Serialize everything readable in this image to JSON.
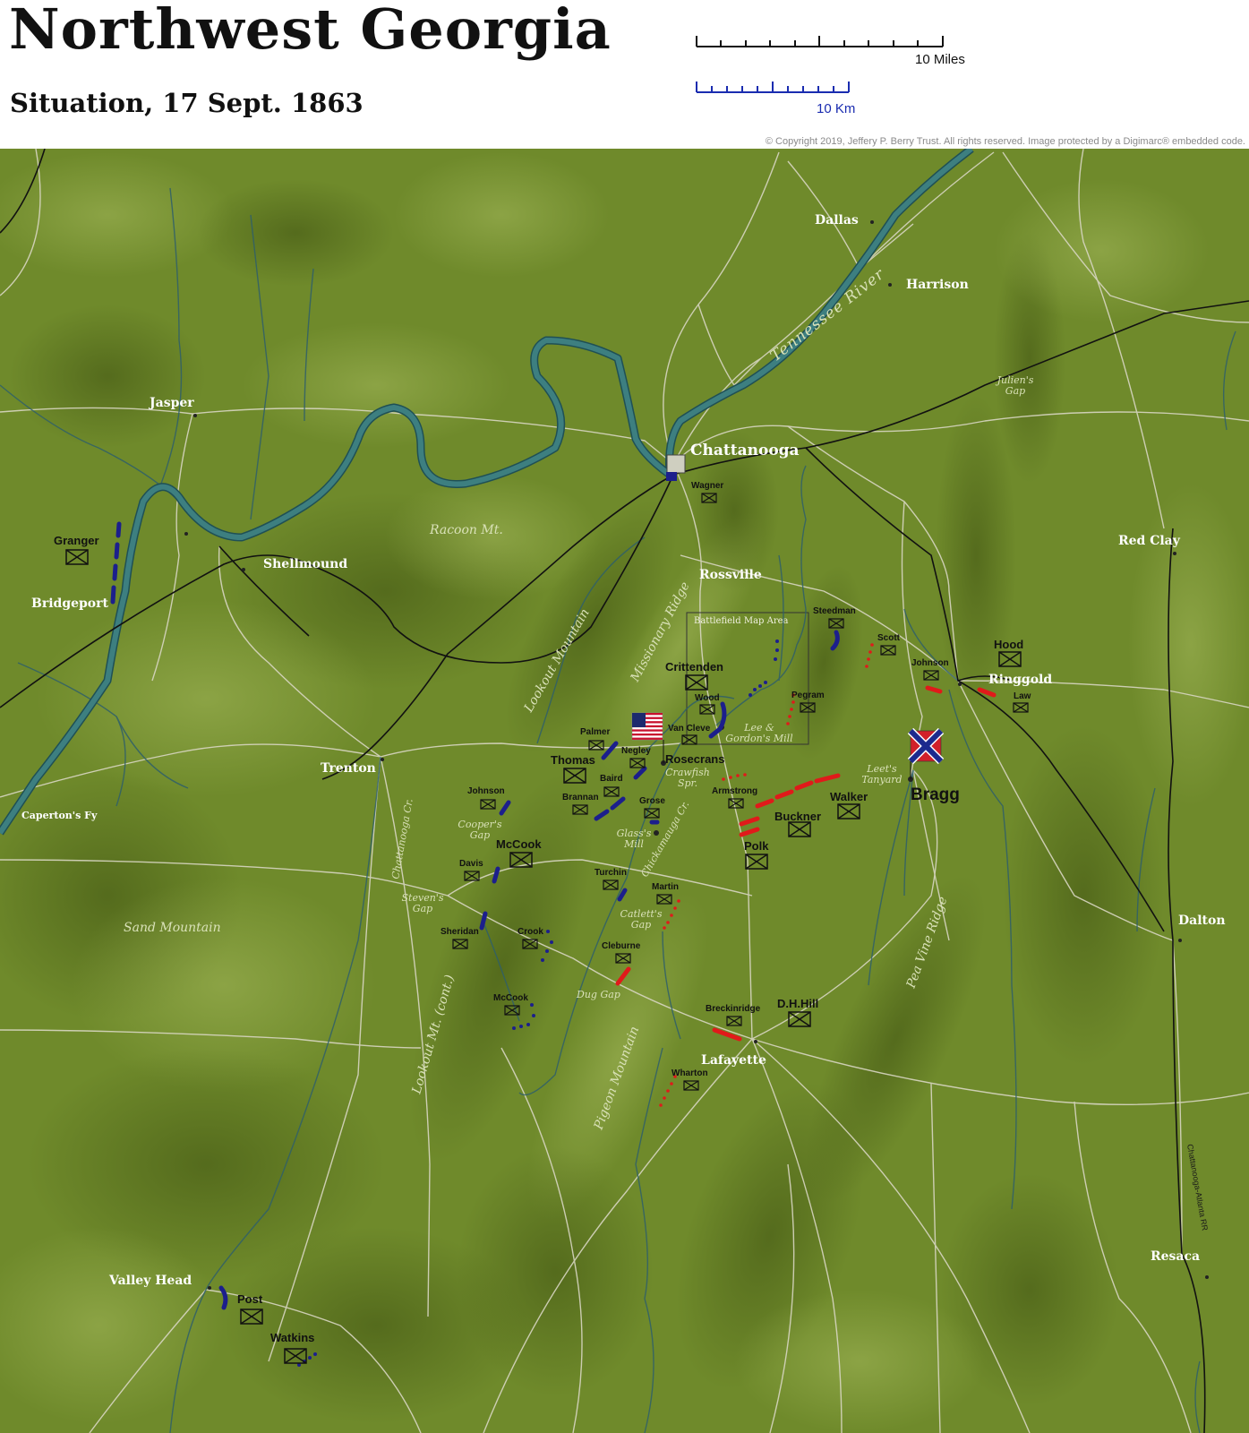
{
  "title": "Northwest Georgia",
  "subtitle": "Situation, 17 Sept. 1863",
  "scale": {
    "miles_label": "10 Miles",
    "km_label": "10 Km"
  },
  "copyright": "© Copyright 2019, Jeffery P. Berry Trust. All rights reserved. Image protected by a Digimarc® embedded code.",
  "colors": {
    "terrain": "#6f8a2b",
    "river": "#2f6f73",
    "union": "#1c1f8c",
    "confederate": "#e01a1a",
    "road": "#d8d6c2",
    "railroad": "#111111"
  },
  "places": {
    "chattanooga": "Chattanooga",
    "dallas": "Dallas",
    "harrison": "Harrison",
    "jasper": "Jasper",
    "shellmound": "Shellmound",
    "bridgeport": "Bridgeport",
    "rossville": "Rossville",
    "trenton": "Trenton",
    "capertons_fy": "Caperton's Fy",
    "red_clay": "Red Clay",
    "ringgold": "Ringgold",
    "dalton": "Dalton",
    "lafayette": "Lafayette",
    "resaca": "Resaca",
    "valley_head": "Valley Head",
    "lees_tanyard": "Leet's\nTanyard",
    "crawfish_spr": "Crawfish\nSpr.",
    "glass_mill": "Glass's\nMill",
    "lee_gordons_mill": "Lee &\nGordon's Mill",
    "coopers_gap": "Cooper's\nGap",
    "stevens_gap": "Steven's\nGap",
    "catletts_gap": "Catlett's\nGap",
    "dug_gap": "Dug Gap",
    "julians_gap": "Julien's\nGap"
  },
  "terrain_labels": {
    "tennessee_river": "Tennessee River",
    "racoon_mt": "Racoon Mt.",
    "sand_mountain": "Sand Mountain",
    "lookout_mountain": "Lookout Mountain",
    "lookout_mt_cont": "Lookout Mt. (cont.)",
    "missionary_ridge": "Missionary Ridge",
    "pigeon_mountain": "Pigeon Mountain",
    "pea_vine_ridge": "Pea Vine Ridge",
    "chattanooga_cr": "Chattanooga Cr.",
    "chickamauga_cr": "Chickamauga Cr."
  },
  "railroad_label": "Chattanooga-Atlanta RR",
  "battlefield_box_label": "Battlefield Map Area",
  "union": {
    "commander": "Rosecrans",
    "corps": {
      "thomas": "Thomas",
      "mccook": "McCook",
      "crittenden": "Crittenden",
      "granger": "Granger"
    },
    "divisions": {
      "wagner": "Wagner",
      "palmer": "Palmer",
      "negley": "Negley",
      "baird": "Baird",
      "brannan": "Brannan",
      "van_cleve": "Van Cleve",
      "wood": "Wood",
      "johnson": "Johnson",
      "davis": "Davis",
      "sheridan": "Sheridan",
      "crook": "Crook",
      "mccook_cav": "McCook",
      "steedman": "Steedman",
      "post": "Post",
      "watkins": "Watkins"
    }
  },
  "confederate": {
    "commander": "Bragg",
    "corps": {
      "polk": "Polk",
      "walker": "Walker",
      "buckner": "Buckner",
      "dh_hill": "D.H.Hill",
      "hood": "Hood"
    },
    "divisions": {
      "armstrong": "Armstrong",
      "pegram": "Pegram",
      "scott": "Scott",
      "johnson": "Johnson",
      "law": "Law",
      "grose": "Grose",
      "turchin": "Turchin",
      "martin": "Martin",
      "cleburne": "Cleburne",
      "breckinridge": "Breckinridge",
      "wharton": "Wharton"
    }
  }
}
